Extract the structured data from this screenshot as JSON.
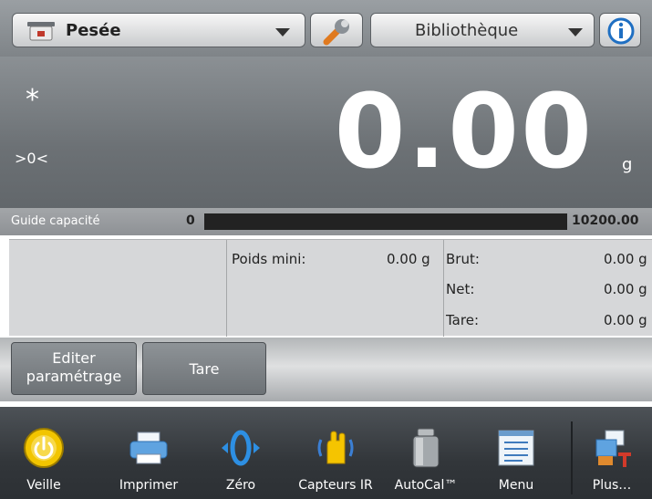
{
  "header": {
    "app_label": "Pesée",
    "library_label": "Bibliothèque",
    "icons": [
      "scale-icon",
      "wrench-icon",
      "info-icon"
    ]
  },
  "display": {
    "stable_indicator": "*",
    "zero_indicator": ">0<",
    "weight_value": "0.00",
    "unit": "g"
  },
  "capacity": {
    "label": "Guide capacité",
    "min": "0",
    "max": "10200.00",
    "fill_fraction": 0
  },
  "info": {
    "min_weight_label": "Poids mini:",
    "min_weight_value": "0.00 g",
    "gross_label": "Brut:",
    "gross_value": "0.00 g",
    "net_label": "Net:",
    "net_value": "0.00 g",
    "tare_label": "Tare:",
    "tare_value": "0.00 g"
  },
  "actions": {
    "edit_line1": "Editer",
    "edit_line2": "paramétrage",
    "tare": "Tare"
  },
  "toolbar": {
    "items": [
      {
        "label": "Veille",
        "icon": "standby-icon"
      },
      {
        "label": "Imprimer",
        "icon": "printer-icon"
      },
      {
        "label": "Zéro",
        "icon": "zero-icon"
      },
      {
        "label": "Capteurs IR",
        "icon": "ir-sensor-icon"
      },
      {
        "label": "AutoCal™",
        "icon": "calibration-weight-icon"
      },
      {
        "label": "Menu",
        "icon": "menu-icon"
      },
      {
        "label": "Plus…",
        "icon": "more-icon"
      }
    ]
  },
  "colors": {
    "weight_text": "#ffffff",
    "toolbar_bg": "#32363a",
    "standby_yellow": "#f2c500",
    "ir_yellow": "#f5c400",
    "zero_blue": "#2d8fe3"
  }
}
